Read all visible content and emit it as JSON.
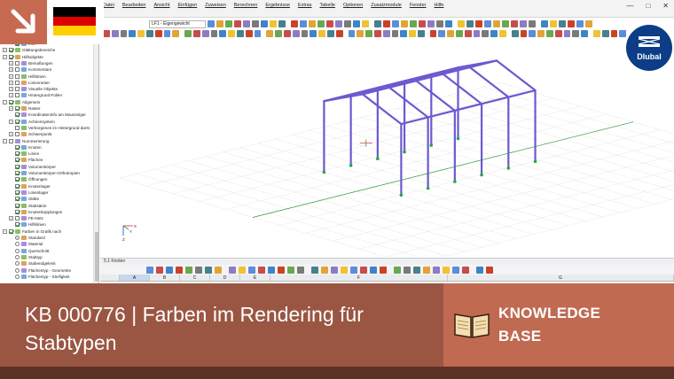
{
  "app": {
    "menu": [
      "Datei",
      "Bearbeiten",
      "Ansicht",
      "Einfügen",
      "Zuweisen",
      "Berechnen",
      "Ergebnisse",
      "Extras",
      "Tabelle",
      "Optionen",
      "Zusatzmodule",
      "Fenster",
      "Hilfe"
    ],
    "loadcase_selector": "LF1 - Eigengewicht",
    "window_controls": [
      "—",
      "□",
      "✕"
    ]
  },
  "navigator": {
    "rows": [
      {
        "label": "Info",
        "level": 2,
        "kind": "check",
        "checked": true
      },
      {
        "label": "Glättungsbereiche",
        "level": 1,
        "kind": "check",
        "checked": true,
        "expander": "+"
      },
      {
        "label": "Hilfsobjekte",
        "level": 1,
        "kind": "check",
        "checked": true,
        "expander": "−"
      },
      {
        "label": "Bemaßungen",
        "level": 2,
        "kind": "check",
        "checked": false,
        "expander": "+"
      },
      {
        "label": "Kommentare",
        "level": 2,
        "kind": "check",
        "checked": false,
        "expander": "+"
      },
      {
        "label": "Hilfslinien",
        "level": 2,
        "kind": "check",
        "checked": false,
        "expander": "+"
      },
      {
        "label": "Linienraster",
        "level": 2,
        "kind": "check",
        "checked": false,
        "expander": "+"
      },
      {
        "label": "Visuelle Objekte",
        "level": 2,
        "kind": "check",
        "checked": false,
        "expander": "+"
      },
      {
        "label": "Hintergrund-Folien",
        "level": 2,
        "kind": "check",
        "checked": false,
        "expander": "+"
      },
      {
        "label": "Allgemein",
        "level": 1,
        "kind": "check",
        "checked": true,
        "expander": "−"
      },
      {
        "label": "Raster",
        "level": 2,
        "kind": "check",
        "checked": true,
        "expander": "+"
      },
      {
        "label": "Koordinateninfo am Mauszeiger",
        "level": 2,
        "kind": "check",
        "checked": true
      },
      {
        "label": "Achsensystem",
        "level": 2,
        "kind": "check",
        "checked": true,
        "expander": "+"
      },
      {
        "label": "Verborgenes im Hintergrund darst",
        "level": 2,
        "kind": "check",
        "checked": false
      },
      {
        "label": "Schwerpunkt",
        "level": 2,
        "kind": "check",
        "checked": false,
        "expander": "+"
      },
      {
        "label": "Nummerierung",
        "level": 1,
        "kind": "check",
        "checked": false,
        "expander": "−"
      },
      {
        "label": "Knoten",
        "level": 2,
        "kind": "check",
        "checked": true
      },
      {
        "label": "Linien",
        "level": 2,
        "kind": "check",
        "checked": true
      },
      {
        "label": "Flächen",
        "level": 2,
        "kind": "check",
        "checked": true
      },
      {
        "label": "Volumenkörper",
        "level": 2,
        "kind": "check",
        "checked": true
      },
      {
        "label": "Volumenkörper-Orthotropien",
        "level": 2,
        "kind": "check",
        "checked": true
      },
      {
        "label": "Öffnungen",
        "level": 2,
        "kind": "check",
        "checked": true
      },
      {
        "label": "Knotenlager",
        "level": 2,
        "kind": "check",
        "checked": true
      },
      {
        "label": "Linienlager",
        "level": 2,
        "kind": "check",
        "checked": true
      },
      {
        "label": "Stäbe",
        "level": 2,
        "kind": "check",
        "checked": true
      },
      {
        "label": "Stabsätze",
        "level": 2,
        "kind": "check",
        "checked": true
      },
      {
        "label": "Knotenkopplungen",
        "level": 2,
        "kind": "check",
        "checked": true
      },
      {
        "label": "FE-Netz",
        "level": 2,
        "kind": "check",
        "checked": false,
        "expander": "+"
      },
      {
        "label": "Hilfslinien",
        "level": 2,
        "kind": "check",
        "checked": true
      },
      {
        "label": "Farben in Grafik nach",
        "level": 1,
        "kind": "check",
        "checked": true,
        "expander": "−"
      },
      {
        "label": "Standard",
        "level": 2,
        "kind": "radio",
        "checked": true
      },
      {
        "label": "Material",
        "level": 2,
        "kind": "radio",
        "checked": false
      },
      {
        "label": "Querschnitt",
        "level": 2,
        "kind": "radio",
        "checked": false
      },
      {
        "label": "Stabtyp",
        "level": 2,
        "kind": "radio",
        "checked": false
      },
      {
        "label": "Stabendgelenk",
        "level": 2,
        "kind": "radio",
        "checked": false
      },
      {
        "label": "Flächentyp - Geometrie",
        "level": 2,
        "kind": "radio",
        "checked": false
      },
      {
        "label": "Flächentyp - Steifigkeit",
        "level": 2,
        "kind": "radio",
        "checked": false
      }
    ]
  },
  "viewport": {
    "axis_labels": {
      "x": "X",
      "y": "Y",
      "z": "Z"
    }
  },
  "table_panel": {
    "title": "5.1 Knoten",
    "columns": [
      "A",
      "B",
      "C",
      "D",
      "E",
      "F",
      "G"
    ]
  },
  "banner": {
    "title": "KB 000776 | Farben im Rendering für Stabtypen",
    "label_line1": "KNOWLEDGE",
    "label_line2": "BASE",
    "icon": "open-book-icon"
  },
  "branding": {
    "logo_text": "Dlubal",
    "flag": "germany-flag-icon",
    "flag_colors": [
      "#000000",
      "#dd0000",
      "#ffce00"
    ],
    "arrow_icon": "arrow-down-right-icon"
  },
  "colors": {
    "member": "#6a5ad0",
    "support": "#22aa44",
    "grid": "#b8b8b8",
    "banner_dark": "#9a5642",
    "banner_light": "#c06a52",
    "dlubal_blue": "#0c3d86"
  }
}
